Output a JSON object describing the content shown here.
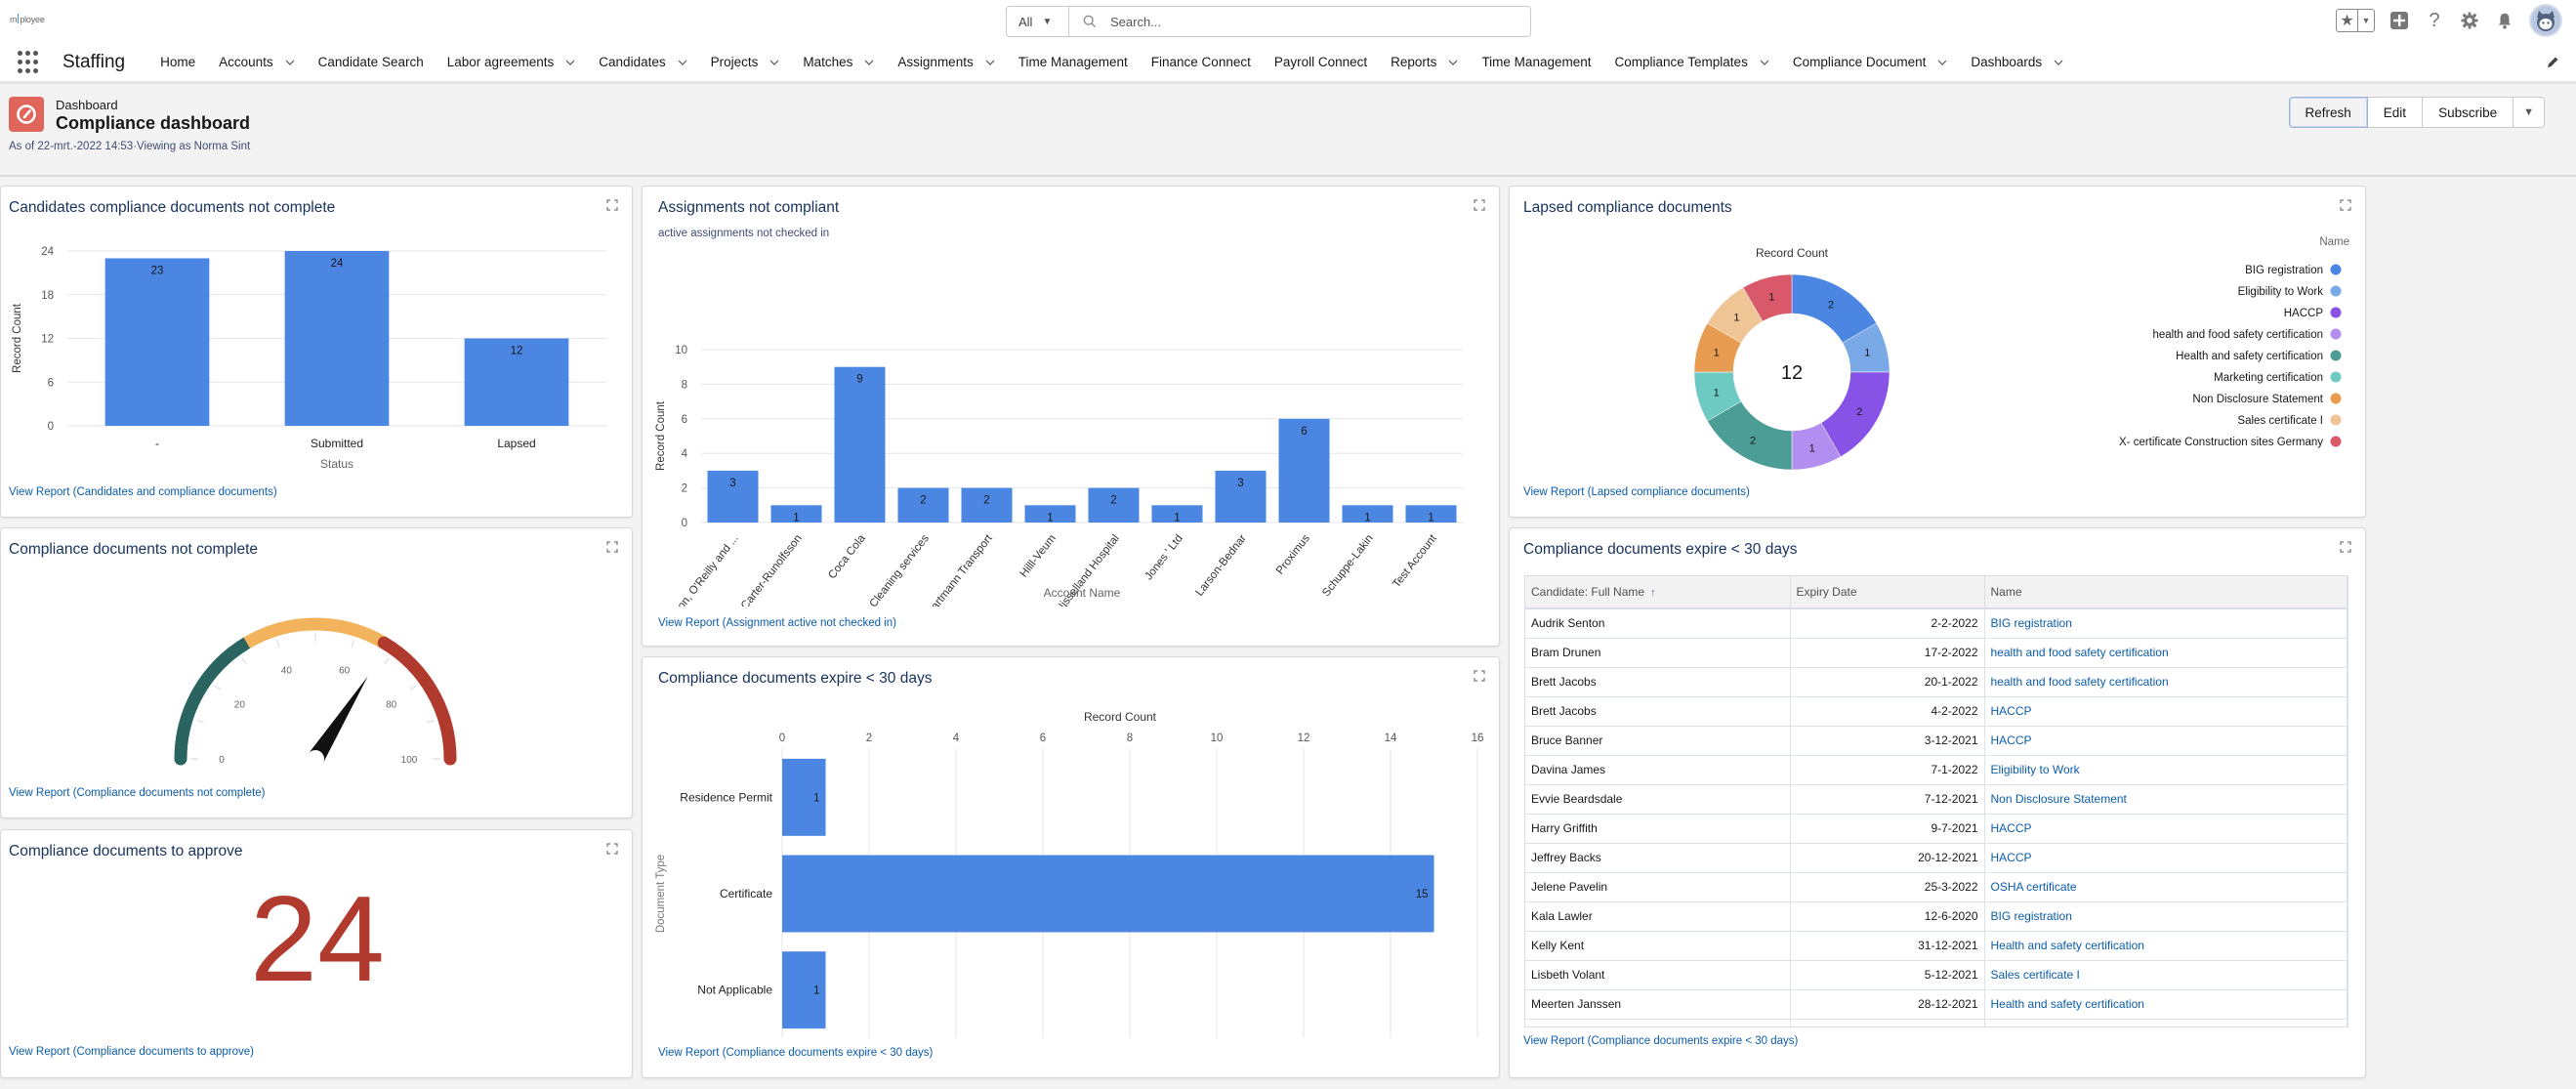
{
  "header": {
    "logo_text_left": "m",
    "logo_text_right": "ployee",
    "search_scope": "All",
    "search_placeholder": "Search...",
    "icons": [
      "favorites-star-icon",
      "favorites-dropdown-icon",
      "add-icon",
      "help-icon",
      "setup-gear-icon",
      "notifications-bell-icon",
      "user-avatar"
    ]
  },
  "nav": {
    "app_name": "Staffing",
    "items": [
      {
        "label": "Home",
        "dropdown": false
      },
      {
        "label": "Accounts",
        "dropdown": true
      },
      {
        "label": "Candidate Search",
        "dropdown": false
      },
      {
        "label": "Labor agreements",
        "dropdown": true
      },
      {
        "label": "Candidates",
        "dropdown": true
      },
      {
        "label": "Projects",
        "dropdown": true
      },
      {
        "label": "Matches",
        "dropdown": true
      },
      {
        "label": "Assignments",
        "dropdown": true
      },
      {
        "label": "Time Management",
        "dropdown": false
      },
      {
        "label": "Finance Connect",
        "dropdown": false
      },
      {
        "label": "Payroll Connect",
        "dropdown": false
      },
      {
        "label": "Reports",
        "dropdown": true
      },
      {
        "label": "Time Management",
        "dropdown": false
      },
      {
        "label": "Compliance Templates",
        "dropdown": true
      },
      {
        "label": "Compliance Document",
        "dropdown": true
      },
      {
        "label": "Dashboards",
        "dropdown": true
      }
    ]
  },
  "page": {
    "kicker": "Dashboard",
    "title": "Compliance dashboard",
    "meta": "As of 22-mrt.-2022 14:53·Viewing as Norma Sint",
    "buttons": {
      "refresh": "Refresh",
      "edit": "Edit",
      "subscribe": "Subscribe"
    }
  },
  "colors": {
    "bar": "#4a86e2",
    "kpi": "#b03a2e",
    "link": "#0b5cab",
    "gauge_low": "#2a6460",
    "gauge_mid": "#f2b35c",
    "gauge_high": "#b03a2e"
  },
  "widgets": {
    "candidates": {
      "title": "Candidates compliance documents not complete",
      "link": "View Report (Candidates and compliance documents)"
    },
    "assignments": {
      "title": "Assignments not compliant",
      "subtitle": "active assignments not checked in",
      "link": "View Report (Assignment active not checked in)"
    },
    "lapsed": {
      "title": "Lapsed compliance documents",
      "link": "View Report (Lapsed compliance documents)"
    },
    "gauge": {
      "title": "Compliance documents not complete",
      "value": 68,
      "min": 0,
      "max": 100,
      "ticks": [
        0,
        20,
        40,
        60,
        80,
        100
      ],
      "bands": [
        {
          "from": 0,
          "to": 33,
          "color": "#2a6460"
        },
        {
          "from": 33,
          "to": 67,
          "color": "#f2b35c"
        },
        {
          "from": 67,
          "to": 100,
          "color": "#b03a2e"
        }
      ],
      "link": "View Report (Compliance documents not complete)"
    },
    "approve": {
      "title": "Compliance documents to approve",
      "value": "24",
      "link": "View Report (Compliance documents to approve)"
    },
    "expire_chart": {
      "title": "Compliance documents expire < 30 days",
      "link": "View Report (Compliance documents expire < 30 days)"
    },
    "expire_table": {
      "title": "Compliance documents expire < 30 days",
      "columns": [
        "Candidate: Full Name",
        "Expiry Date",
        "Name"
      ],
      "sort_indicator": "↑",
      "rows": [
        [
          "Audrik Senton",
          "2-2-2022",
          "BIG registration"
        ],
        [
          "Bram Drunen",
          "17-2-2022",
          "health and food safety certification"
        ],
        [
          "Brett Jacobs",
          "20-1-2022",
          "health and food safety certification"
        ],
        [
          "Brett Jacobs",
          "4-2-2022",
          "HACCP"
        ],
        [
          "Bruce Banner",
          "3-12-2021",
          "HACCP"
        ],
        [
          "Davina James",
          "7-1-2022",
          "Eligibility to Work"
        ],
        [
          "Evvie Beardsdale",
          "7-12-2021",
          "Non Disclosure Statement"
        ],
        [
          "Harry Griffith",
          "9-7-2021",
          "HACCP"
        ],
        [
          "Jeffrey Backs",
          "20-12-2021",
          "HACCP"
        ],
        [
          "Jelene Pavelin",
          "25-3-2022",
          "OSHA certificate"
        ],
        [
          "Kala Lawler",
          "12-6-2020",
          "BIG registration"
        ],
        [
          "Kelly Kent",
          "31-12-2021",
          "Health and safety certification"
        ],
        [
          "Lisbeth Volant",
          "5-12-2021",
          "Sales certificate I"
        ],
        [
          "Meerten Janssen",
          "28-12-2021",
          "Health and safety certification"
        ]
      ],
      "link": "View Report (Compliance documents expire < 30 days)"
    }
  },
  "chart_data": [
    {
      "id": "candidates",
      "type": "bar",
      "title": "Candidates compliance documents not complete",
      "categories": [
        "-",
        "Submitted",
        "Lapsed"
      ],
      "values": [
        23,
        24,
        12
      ],
      "xlabel": "Status",
      "ylabel": "Record Count",
      "ylim": [
        0,
        24
      ],
      "yticks": [
        0,
        6,
        12,
        18,
        24
      ],
      "grid": true
    },
    {
      "id": "assignments",
      "type": "bar",
      "title": "Assignments not compliant",
      "subtitle": "active assignments not checked in",
      "categories": [
        "Anderson, O'Reilly and ...",
        "Carter-Runolfsson",
        "Coca Cola",
        "Drift Cleaning services",
        "Hartmann Transport",
        "Hilll-Veum",
        "Ijsselland Hospital",
        "Jones ' Ltd",
        "Larson-Bednar",
        "Proximus",
        "Schuppe-Lakin",
        "Test Account"
      ],
      "tick_labels": [
        "nderson, O'Reilly and ...",
        "Carter-Runolfsson",
        "Coca Cola",
        "Drift Cleaning services",
        "Hartmann Transport",
        "Hilll-Veum",
        "Ijsselland Hospital",
        "Jones ' Ltd",
        "Larson-Bednar",
        "Proximus",
        "Schuppe-Lakin",
        "Test Account"
      ],
      "values": [
        3,
        1,
        9,
        2,
        2,
        1,
        2,
        1,
        3,
        6,
        1,
        1
      ],
      "xlabel": "Account Name",
      "ylabel": "Record Count",
      "ylim": [
        0,
        10
      ],
      "yticks": [
        0,
        2,
        4,
        6,
        8,
        10
      ],
      "grid": true
    },
    {
      "id": "lapsed",
      "type": "pie",
      "variant": "donut",
      "title": "Lapsed compliance documents",
      "subtitle": "Record Count",
      "total": 12,
      "legend_title": "Name",
      "legend_position": "right",
      "slices": [
        {
          "label": "BIG registration",
          "value": 2,
          "color": "#4a86e2"
        },
        {
          "label": "Eligibility to Work",
          "value": 1,
          "color": "#7aa9e8"
        },
        {
          "label": "HACCP",
          "value": 2,
          "color": "#8752e6"
        },
        {
          "label": "health and food safety certification",
          "value": 1,
          "color": "#b28ef0"
        },
        {
          "label": "Health and safety certification",
          "value": 2,
          "color": "#4c9d96"
        },
        {
          "label": "Marketing certification",
          "value": 1,
          "color": "#6ccac3"
        },
        {
          "label": "Non Disclosure Statement",
          "value": 1,
          "color": "#e89c51"
        },
        {
          "label": "Sales certificate I",
          "value": 1,
          "color": "#f0c596"
        },
        {
          "label": "X- certificate Construction sites Germany",
          "value": 1,
          "color": "#d9596a"
        }
      ]
    },
    {
      "id": "expire",
      "type": "bar",
      "orientation": "horizontal",
      "title": "Compliance documents expire < 30 days",
      "categories": [
        "Residence Permit",
        "Certificate",
        "Not Applicable"
      ],
      "values": [
        1,
        15,
        1
      ],
      "xlabel": "Record Count",
      "ylabel": "Document Type",
      "xlim": [
        0,
        16
      ],
      "xticks": [
        0,
        2,
        4,
        6,
        8,
        10,
        12,
        14,
        16
      ],
      "grid": true
    }
  ]
}
